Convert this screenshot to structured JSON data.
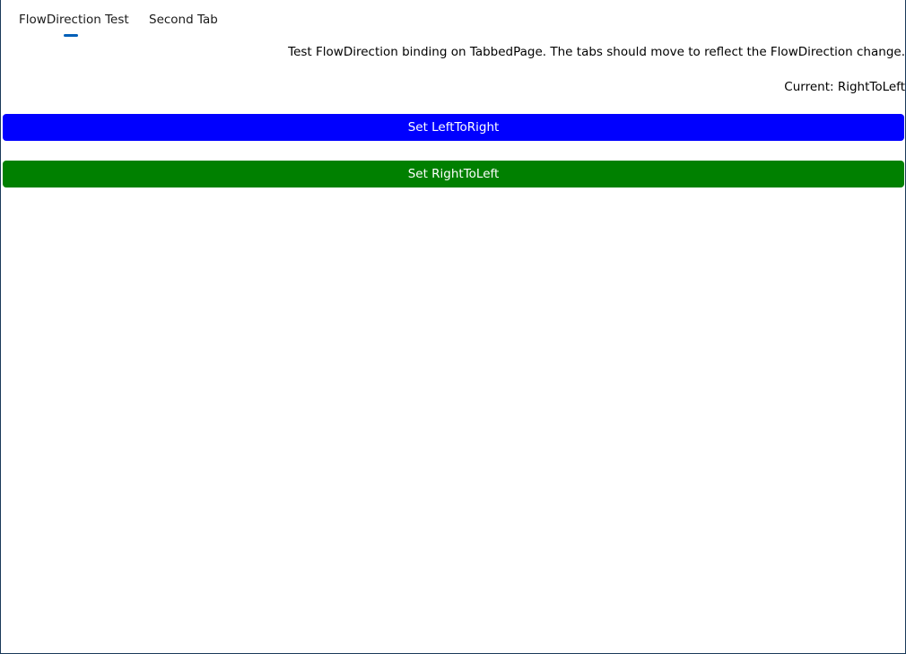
{
  "tabs": [
    {
      "label": "FlowDirection Test",
      "selected": true
    },
    {
      "label": "Second Tab",
      "selected": false
    }
  ],
  "main": {
    "description": "Test FlowDirection binding on TabbedPage. The tabs should move to reflect the FlowDirection change.",
    "current_label": "Current: RightToLeft"
  },
  "buttons": {
    "ltr_label": "Set LeftToRight",
    "rtl_label": "Set RightToLeft"
  },
  "colors": {
    "ltr_button": "#0000ff",
    "rtl_button": "#008000",
    "tab_indicator": "#005fb8"
  }
}
